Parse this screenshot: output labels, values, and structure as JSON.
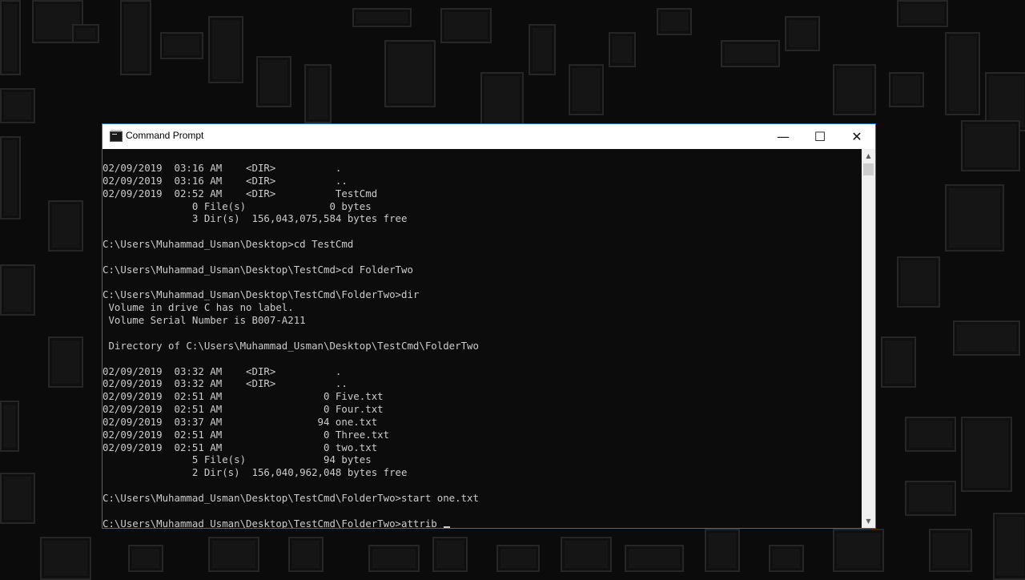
{
  "window": {
    "title": "Command Prompt",
    "minimize_glyph": "—",
    "maximize_glyph": "☐",
    "close_glyph": "✕"
  },
  "console": {
    "lines": [
      "02/09/2019  03:16 AM    <DIR>          .",
      "02/09/2019  03:16 AM    <DIR>          ..",
      "02/09/2019  02:52 AM    <DIR>          TestCmd",
      "               0 File(s)              0 bytes",
      "               3 Dir(s)  156,043,075,584 bytes free",
      "",
      "C:\\Users\\Muhammad_Usman\\Desktop>cd TestCmd",
      "",
      "C:\\Users\\Muhammad_Usman\\Desktop\\TestCmd>cd FolderTwo",
      "",
      "C:\\Users\\Muhammad_Usman\\Desktop\\TestCmd\\FolderTwo>dir",
      " Volume in drive C has no label.",
      " Volume Serial Number is B007-A211",
      "",
      " Directory of C:\\Users\\Muhammad_Usman\\Desktop\\TestCmd\\FolderTwo",
      "",
      "02/09/2019  03:32 AM    <DIR>          .",
      "02/09/2019  03:32 AM    <DIR>          ..",
      "02/09/2019  02:51 AM                 0 Five.txt",
      "02/09/2019  02:51 AM                 0 Four.txt",
      "02/09/2019  03:37 AM                94 one.txt",
      "02/09/2019  02:51 AM                 0 Three.txt",
      "02/09/2019  02:51 AM                 0 two.txt",
      "               5 File(s)             94 bytes",
      "               2 Dir(s)  156,040,962,048 bytes free",
      "",
      "C:\\Users\\Muhammad_Usman\\Desktop\\TestCmd\\FolderTwo>start one.txt",
      ""
    ],
    "prompt_line": "C:\\Users\\Muhammad_Usman\\Desktop\\TestCmd\\FolderTwo>attrib"
  },
  "scrollbar": {
    "up_glyph": "▲",
    "down_glyph": "▼"
  }
}
